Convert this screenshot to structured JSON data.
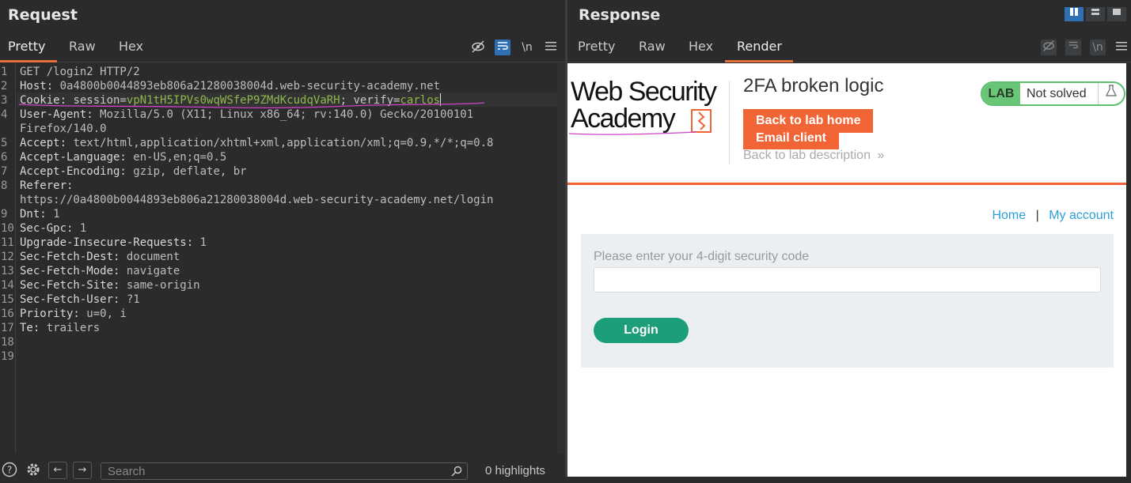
{
  "request": {
    "title": "Request",
    "tabs": [
      "Pretty",
      "Raw",
      "Hex"
    ],
    "active_tab": "Pretty",
    "tools": {
      "eye_off": "hide-icon",
      "wrap": "wrap-icon",
      "newline": "\\n",
      "menu": "menu-icon"
    },
    "lines": [
      {
        "n": "1",
        "key": "",
        "val": "GET /login2 HTTP/2"
      },
      {
        "n": "2",
        "key": "Host: ",
        "val": "0a4800b0044893eb806a21280038004d.web-security-academy.net"
      },
      {
        "n": "3",
        "key": "Cookie: ",
        "cookie": [
          {
            "name": "session",
            "value": "vpN1tH5IPVs0wqWSfeP9ZMdKcudqVaRH"
          },
          {
            "name": "verify",
            "value": "carlos"
          }
        ]
      },
      {
        "n": "4",
        "key": "User-Agent: ",
        "val": "Mozilla/5.0 (X11; Linux x86_64; rv:140.0) Gecko/20100101"
      },
      {
        "n": "",
        "key": "",
        "val": "Firefox/140.0"
      },
      {
        "n": "5",
        "key": "Accept: ",
        "val": "text/html,application/xhtml+xml,application/xml;q=0.9,*/*;q=0.8"
      },
      {
        "n": "6",
        "key": "Accept-Language: ",
        "val": "en-US,en;q=0.5"
      },
      {
        "n": "7",
        "key": "Accept-Encoding: ",
        "val": "gzip, deflate, br"
      },
      {
        "n": "8",
        "key": "Referer: ",
        "val": ""
      },
      {
        "n": "",
        "key": "",
        "val": "https://0a4800b0044893eb806a21280038004d.web-security-academy.net/login"
      },
      {
        "n": "9",
        "key": "Dnt: ",
        "val": "1"
      },
      {
        "n": "10",
        "key": "Sec-Gpc: ",
        "val": "1"
      },
      {
        "n": "11",
        "key": "Upgrade-Insecure-Requests: ",
        "val": "1"
      },
      {
        "n": "12",
        "key": "Sec-Fetch-Dest: ",
        "val": "document"
      },
      {
        "n": "13",
        "key": "Sec-Fetch-Mode: ",
        "val": "navigate"
      },
      {
        "n": "14",
        "key": "Sec-Fetch-Site: ",
        "val": "same-origin"
      },
      {
        "n": "15",
        "key": "Sec-Fetch-User: ",
        "val": "?1"
      },
      {
        "n": "16",
        "key": "Priority: ",
        "val": "u=0, i"
      },
      {
        "n": "17",
        "key": "Te: ",
        "val": "trailers"
      },
      {
        "n": "18",
        "key": "",
        "val": ""
      },
      {
        "n": "19",
        "key": "",
        "val": ""
      }
    ],
    "search_placeholder": "Search",
    "highlights": "0 highlights"
  },
  "response": {
    "title": "Response",
    "tabs": [
      "Pretty",
      "Raw",
      "Hex",
      "Render"
    ],
    "active_tab": "Render",
    "tools": {
      "eye_off": "hide-icon",
      "wrap": "wrap-icon",
      "newline": "\\n",
      "menu": "menu-icon"
    },
    "render": {
      "logo_line1": "Web Security",
      "logo_line2": "Academy",
      "lab_title": "2FA broken logic",
      "back_home": "Back to lab home",
      "email_client": "Email client",
      "back_desc": "Back to lab description",
      "badge_lab": "LAB",
      "badge_state": "Not solved",
      "nav_home": "Home",
      "nav_sep": "|",
      "nav_account": "My account",
      "code_label": "Please enter your 4-digit security code",
      "login_label": "Login"
    }
  },
  "colors": {
    "accent": "#e8703a",
    "cookie_value": "#8fb84c",
    "academy_orange": "#f06435",
    "login_green": "#1d9e7a",
    "link_blue": "#2b9fd8",
    "annotation_pink": "#d042c8"
  }
}
